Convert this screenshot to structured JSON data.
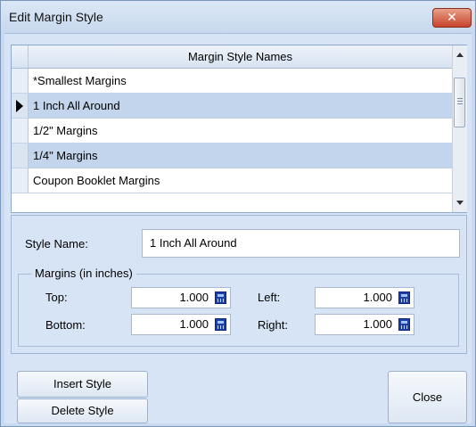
{
  "window": {
    "title": "Edit Margin Style",
    "close_glyph": "✕"
  },
  "grid": {
    "header": "Margin Style Names",
    "rows": [
      {
        "name": "*Smallest Margins",
        "current": false
      },
      {
        "name": "1 Inch All Around",
        "current": true
      },
      {
        "name": "1/2\" Margins",
        "current": false
      },
      {
        "name": "1/4\" Margins",
        "current": false
      },
      {
        "name": "Coupon Booklet Margins",
        "current": false
      }
    ]
  },
  "details": {
    "style_name_label": "Style Name:",
    "style_name_value": "1 Inch All Around",
    "margins_group": "Margins (in inches)",
    "top_label": "Top:",
    "top_value": "1.000",
    "bottom_label": "Bottom:",
    "bottom_value": "1.000",
    "left_label": "Left:",
    "left_value": "1.000",
    "right_label": "Right:",
    "right_value": "1.000"
  },
  "buttons": {
    "insert": "Insert Style",
    "delete": "Delete Style",
    "close": "Close"
  },
  "icons": {
    "calculator": "calculator-icon",
    "close": "close-icon",
    "row_pointer": "row-pointer-icon"
  },
  "colors": {
    "title_bar": "#c9daf0",
    "close_button": "#c7442b",
    "alt_row": "#c2d5ec",
    "calculator": "#1f3fa8"
  }
}
